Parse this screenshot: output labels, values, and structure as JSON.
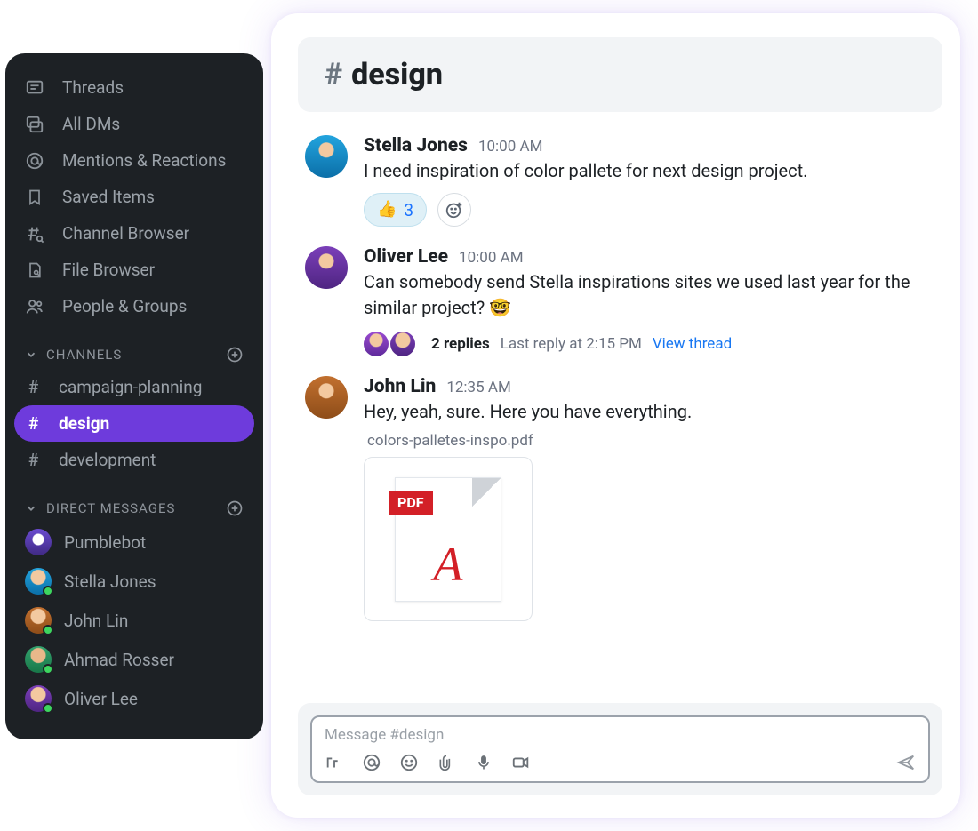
{
  "sidebar": {
    "nav": [
      {
        "icon": "threads",
        "label": "Threads"
      },
      {
        "icon": "dms",
        "label": "All DMs"
      },
      {
        "icon": "mentions",
        "label": "Mentions & Reactions"
      },
      {
        "icon": "saved",
        "label": "Saved Items"
      },
      {
        "icon": "channelbrowser",
        "label": "Channel Browser"
      },
      {
        "icon": "filebrowser",
        "label": "File Browser"
      },
      {
        "icon": "people",
        "label": "People & Groups"
      }
    ],
    "channels_header": "CHANNELS",
    "channels": [
      {
        "name": "campaign-planning",
        "active": false
      },
      {
        "name": "design",
        "active": true
      },
      {
        "name": "development",
        "active": false
      }
    ],
    "dm_header": "DIRECT MESSAGES",
    "dms": [
      {
        "name": "Pumblebot",
        "avatar": "bot",
        "presence": false
      },
      {
        "name": "Stella Jones",
        "avatar": "stella",
        "presence": true
      },
      {
        "name": "John Lin",
        "avatar": "john",
        "presence": true
      },
      {
        "name": "Ahmad Rosser",
        "avatar": "ahmad",
        "presence": true
      },
      {
        "name": "Oliver Lee",
        "avatar": "oliver",
        "presence": true
      }
    ]
  },
  "channel": {
    "hash": "#",
    "name": "design"
  },
  "messages": {
    "m0": {
      "author": "Stella Jones",
      "time": "10:00 AM",
      "body": "I need inspiration of color pallete for next design project.",
      "reaction_emoji": "👍",
      "reaction_count": "3"
    },
    "m1": {
      "author": "Oliver Lee",
      "time": "10:00 AM",
      "body": "Can somebody send Stella inspirations sites we used last year for the similar project? 🤓",
      "replies": "2 replies",
      "last_reply": "Last reply at 2:15 PM",
      "view": "View thread"
    },
    "m2": {
      "author": "John Lin",
      "time": "12:35 AM",
      "body": "Hey, yeah, sure. Here you have everything.",
      "attachment_name": "colors-palletes-inspo.pdf",
      "pdf_label": "PDF"
    }
  },
  "composer": {
    "placeholder": "Message #design"
  }
}
